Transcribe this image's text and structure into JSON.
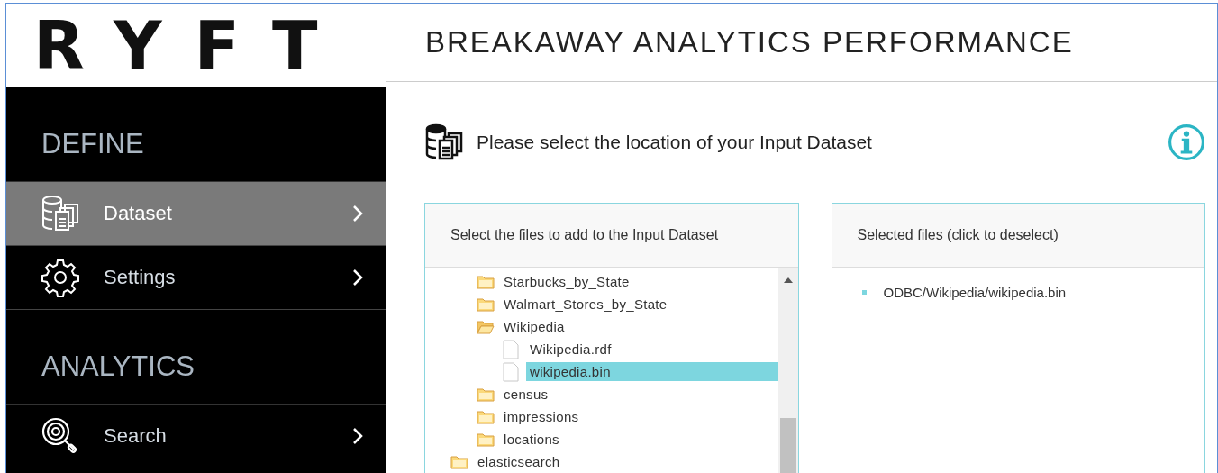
{
  "logo": {
    "text": "RYFT"
  },
  "header": {
    "title": "BREAKAWAY ANALYTICS PERFORMANCE"
  },
  "sidebar": {
    "sections": [
      {
        "title": "DEFINE",
        "items": [
          {
            "label": "Dataset",
            "kind": "dataset",
            "selected": true
          },
          {
            "label": "Settings",
            "kind": "settings",
            "selected": false
          }
        ]
      },
      {
        "title": "ANALYTICS",
        "items": [
          {
            "label": "Search",
            "kind": "search",
            "selected": false
          }
        ]
      }
    ]
  },
  "prompt": {
    "text": "Please select the location of your Input Dataset"
  },
  "file_picker": {
    "title": "Select the files to add to the Input Dataset",
    "tree": [
      {
        "kind": "group",
        "children": [
          {
            "kind": "folder",
            "label": "Starbucks_by_State",
            "expanded": false
          },
          {
            "kind": "folder",
            "label": "Walmart_Stores_by_State",
            "expanded": false
          },
          {
            "kind": "folder",
            "label": "Wikipedia",
            "expanded": true,
            "children": [
              {
                "kind": "file",
                "label": "Wikipedia.rdf",
                "selected": false
              },
              {
                "kind": "file",
                "label": "wikipedia.bin",
                "selected": true
              }
            ]
          },
          {
            "kind": "folder",
            "label": "census",
            "expanded": false
          },
          {
            "kind": "folder",
            "label": "impressions",
            "expanded": false
          },
          {
            "kind": "folder",
            "label": "locations",
            "expanded": false
          }
        ]
      },
      {
        "kind": "folder",
        "label": "elasticsearch",
        "expanded": false
      }
    ]
  },
  "selected_files": {
    "title": "Selected files (click to deselect)",
    "items": [
      "ODBC/Wikipedia/wikipedia.bin"
    ]
  }
}
